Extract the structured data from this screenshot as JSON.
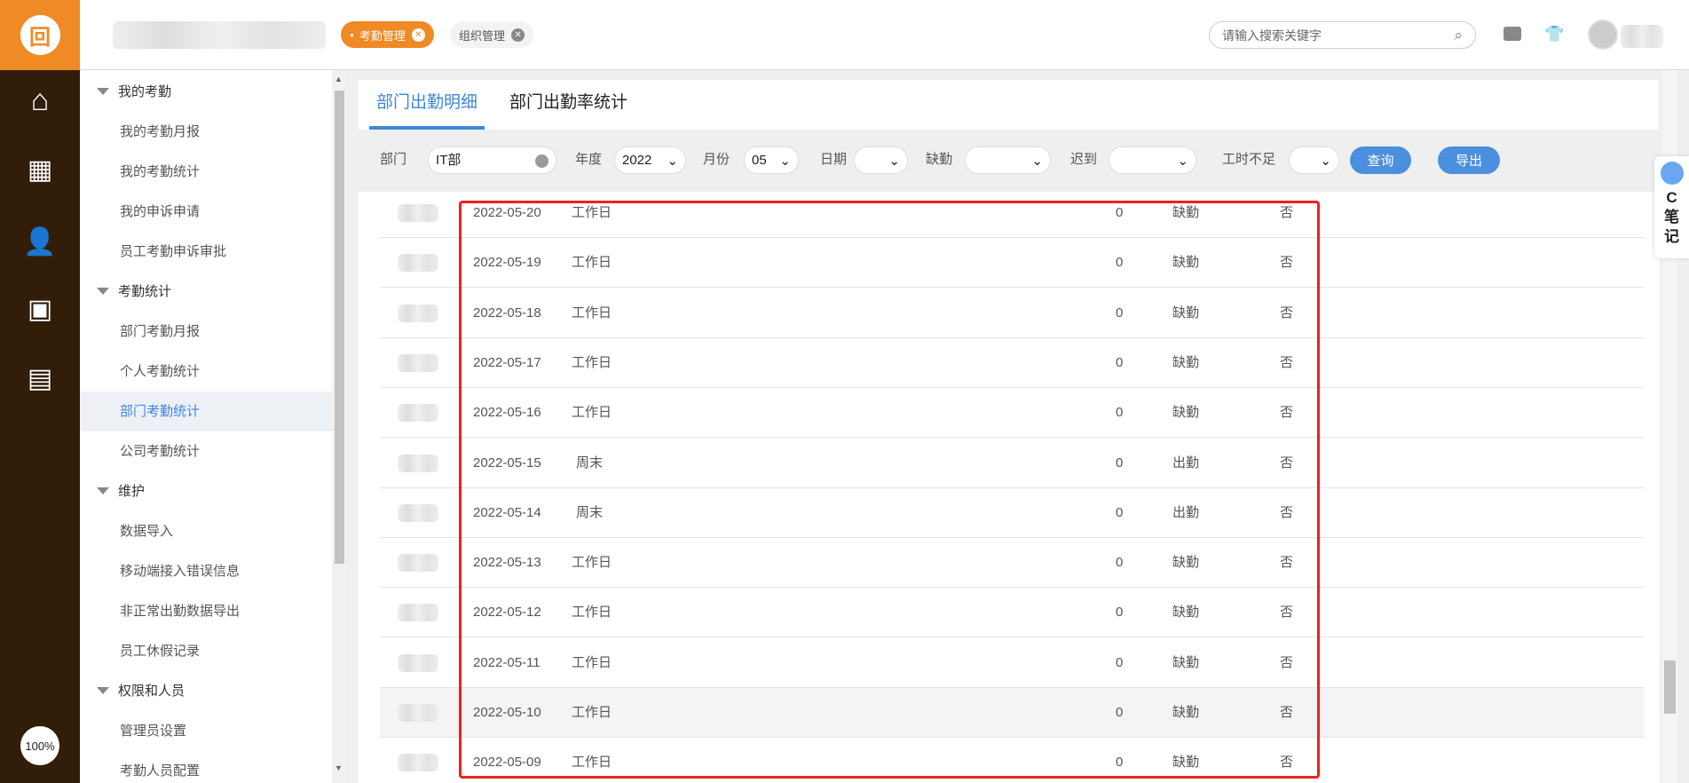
{
  "app": {
    "zoom_level": "100%"
  },
  "header": {
    "tabs": [
      {
        "label": "考勤管理",
        "active": true
      },
      {
        "label": "组织管理",
        "active": false
      }
    ],
    "search_placeholder": "请输入搜索关键字"
  },
  "menu": {
    "items": [
      {
        "label": "我的考勤",
        "group": true
      },
      {
        "label": "我的考勤月报"
      },
      {
        "label": "我的考勤统计"
      },
      {
        "label": "我的申诉申请"
      },
      {
        "label": "员工考勤申诉审批"
      },
      {
        "label": "考勤统计",
        "group": true
      },
      {
        "label": "部门考勤月报"
      },
      {
        "label": "个人考勤统计"
      },
      {
        "label": "部门考勤统计",
        "active": true
      },
      {
        "label": "公司考勤统计"
      },
      {
        "label": "维护",
        "group": true
      },
      {
        "label": "数据导入"
      },
      {
        "label": "移动端接入错误信息"
      },
      {
        "label": "非正常出勤数据导出"
      },
      {
        "label": "员工休假记录"
      },
      {
        "label": "权限和人员",
        "group": true
      },
      {
        "label": "管理员设置"
      },
      {
        "label": "考勤人员配置"
      }
    ]
  },
  "page_tabs": [
    {
      "label": "部门出勤明细",
      "active": true
    },
    {
      "label": "部门出勤率统计"
    }
  ],
  "filters": {
    "dept_label": "部门",
    "dept_value": "IT部",
    "year_label": "年度",
    "year_value": "2022",
    "month_label": "月份",
    "month_value": "05",
    "date_label": "日期",
    "date_value": "",
    "absence_label": "缺勤",
    "absence_value": "",
    "late_label": "迟到",
    "late_value": "",
    "short_hours_label": "工时不足",
    "short_hours_value": "",
    "query_button": "查询",
    "export_button": "导出"
  },
  "table": {
    "rows": [
      {
        "date": "2022-05-20",
        "type": "工作日",
        "value": "0",
        "status": "缺勤",
        "flag": "否"
      },
      {
        "date": "2022-05-19",
        "type": "工作日",
        "value": "0",
        "status": "缺勤",
        "flag": "否"
      },
      {
        "date": "2022-05-18",
        "type": "工作日",
        "value": "0",
        "status": "缺勤",
        "flag": "否"
      },
      {
        "date": "2022-05-17",
        "type": "工作日",
        "value": "0",
        "status": "缺勤",
        "flag": "否"
      },
      {
        "date": "2022-05-16",
        "type": "工作日",
        "value": "0",
        "status": "缺勤",
        "flag": "否"
      },
      {
        "date": "2022-05-15",
        "type": "周末",
        "value": "0",
        "status": "出勤",
        "flag": "否"
      },
      {
        "date": "2022-05-14",
        "type": "周末",
        "value": "0",
        "status": "出勤",
        "flag": "否"
      },
      {
        "date": "2022-05-13",
        "type": "工作日",
        "value": "0",
        "status": "缺勤",
        "flag": "否"
      },
      {
        "date": "2022-05-12",
        "type": "工作日",
        "value": "0",
        "status": "缺勤",
        "flag": "否"
      },
      {
        "date": "2022-05-11",
        "type": "工作日",
        "value": "0",
        "status": "缺勤",
        "flag": "否"
      },
      {
        "date": "2022-05-10",
        "type": "工作日",
        "value": "0",
        "status": "缺勤",
        "flag": "否",
        "highlighted": true
      },
      {
        "date": "2022-05-09",
        "type": "工作日",
        "value": "0",
        "status": "缺勤",
        "flag": "否"
      }
    ]
  },
  "note_widget": {
    "label1": "C",
    "label2": "笔",
    "label3": "记"
  },
  "colors": {
    "accent": "#3d87db",
    "brand": "#ef8a25",
    "rail": "#321d09",
    "highlight_box": "#f02020"
  }
}
